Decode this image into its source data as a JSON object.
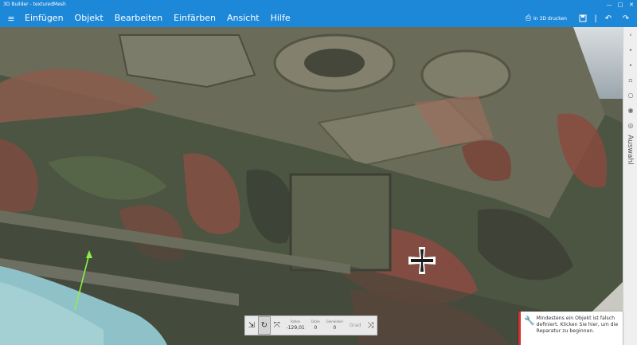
{
  "window": {
    "title": "3D Builder - texturedMesh",
    "minimize": "—",
    "maximize": "□",
    "close": "✕"
  },
  "menu": {
    "items": [
      "Einfügen",
      "Objekt",
      "Bearbeiten",
      "Einfärben",
      "Ansicht",
      "Hilfe"
    ]
  },
  "toolbar": {
    "print_label": "In 3D drucken",
    "save": "save",
    "undo": "undo",
    "redo": "redo"
  },
  "sidebar": {
    "label": "Auswahl"
  },
  "bottom": {
    "rollen_label": "Rollen",
    "rollen_value": "-129,01",
    "dicke_label": "Dicke",
    "dicke_value": "0",
    "gierwinkel_label": "Gierwinkel",
    "gierwinkel_value": "0",
    "unit": "Grad"
  },
  "notification": {
    "text": "Mindestens ein Objekt ist falsch definiert. Klicken Sie hier, um die Reparatur zu beginnen."
  },
  "colors": {
    "accent": "#1e88d8",
    "error": "#d32f2f"
  }
}
